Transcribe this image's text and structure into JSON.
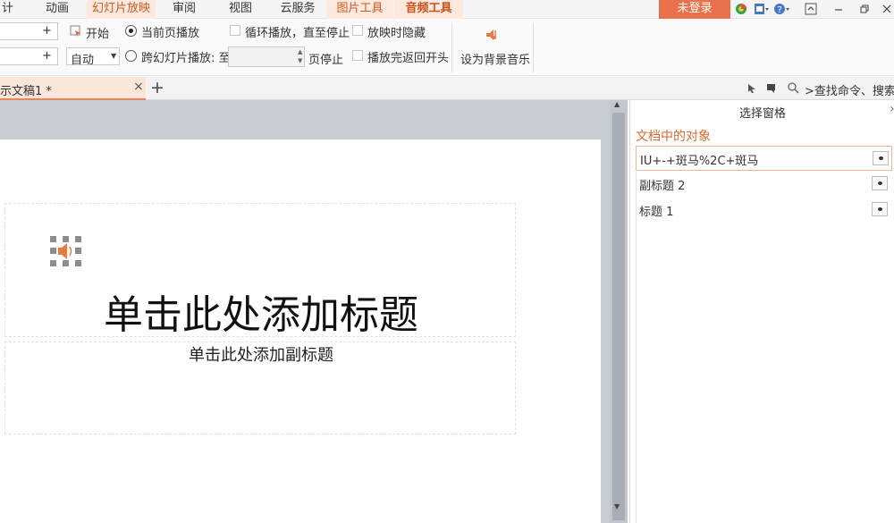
{
  "menu": {
    "tabs": [
      {
        "label": "计"
      },
      {
        "label": "动画"
      },
      {
        "label": "幻灯片放映"
      },
      {
        "label": "审阅"
      },
      {
        "label": "视图"
      },
      {
        "label": "云服务"
      },
      {
        "label": "图片工具"
      },
      {
        "label": "音频工具"
      }
    ],
    "login": "未登录"
  },
  "ribbon": {
    "start_label": "开始",
    "volume_value": "自动",
    "play_current": "当前页播放",
    "play_across": "跨幻灯片播放: 至",
    "page_stop": "页停止",
    "loop_label": "循环播放，直至停止",
    "hide_label": "放映时隐藏",
    "rewind_label": "播放完返回开头",
    "bgmusic_label": "设为背景音乐"
  },
  "document": {
    "tab_title": "示文稿1 *",
    "find_command": ">查找命令、搜索..."
  },
  "slide": {
    "title_placeholder": "单击此处添加标题",
    "subtitle_placeholder": "单击此处添加副标题"
  },
  "selection_pane": {
    "title": "选择窗格",
    "subtitle": "文档中的对象",
    "objects": [
      {
        "label": "IU+-+斑马%2C+斑马"
      },
      {
        "label": "副标题 2"
      },
      {
        "label": "标题 1"
      }
    ]
  },
  "colors": {
    "accent": "#e8704a",
    "tab_highlight": "#fde9de",
    "pane_heading": "#d9692f",
    "canvas_bg": "#c9ccd3"
  }
}
